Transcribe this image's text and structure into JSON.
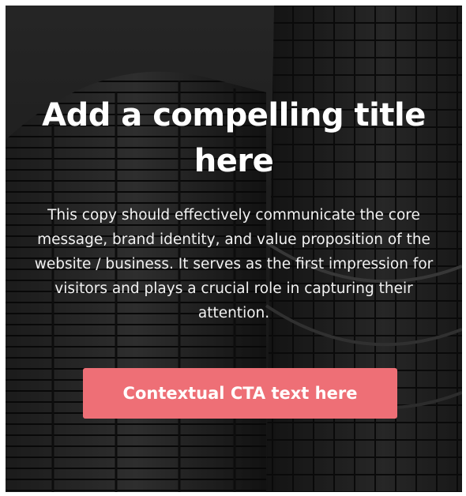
{
  "hero": {
    "background_image": "skyscraper-glass-facade",
    "title": "Add a compelling title here",
    "copy": "This copy should effectively communicate the core message, brand identity, and value proposition of the website / business. It serves as the first impression for visitors and plays a crucial role in capturing their attention.",
    "cta_label": "Contextual CTA text here"
  },
  "colors": {
    "cta_background": "#ee6f76",
    "text": "#ffffff",
    "overlay": "#1b1b1b"
  }
}
